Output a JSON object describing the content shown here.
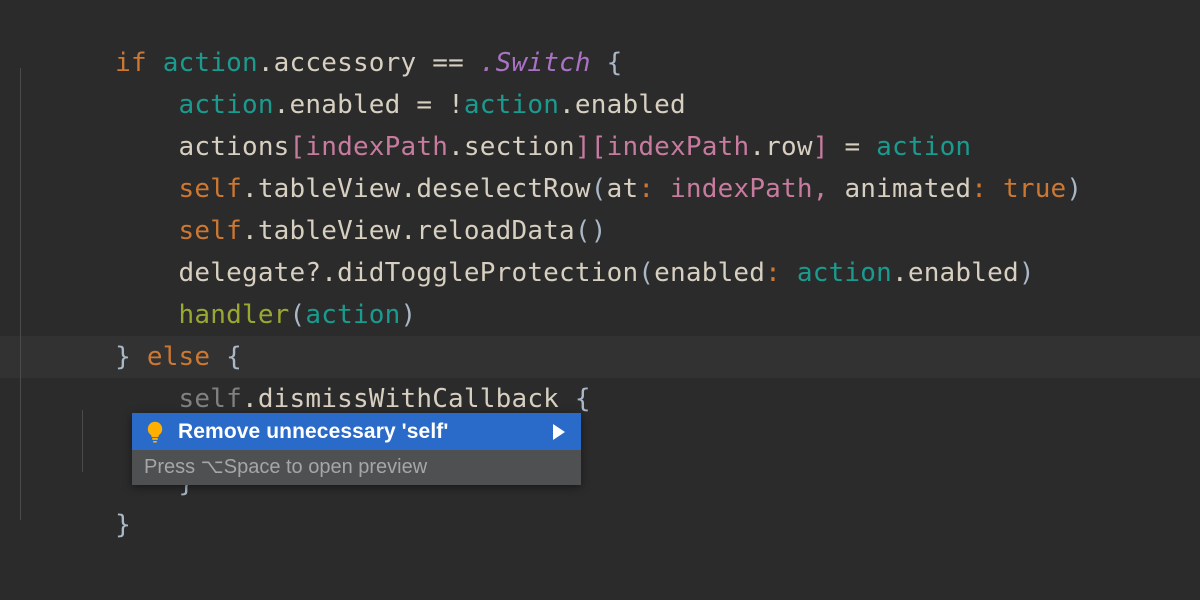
{
  "editor": {
    "background_color": "#2b2b2b",
    "current_line_color": "#323232",
    "font_size_px": 26,
    "lines": [
      {
        "id": "line-1",
        "text": "if action.accessory == .Switch {"
      },
      {
        "id": "line-2",
        "text": "    action.enabled = !action.enabled"
      },
      {
        "id": "line-3",
        "text": "    actions[indexPath.section][indexPath.row] = action"
      },
      {
        "id": "line-4",
        "text": "    self.tableView.deselectRow(at: indexPath, animated: true)"
      },
      {
        "id": "line-5",
        "text": "    self.tableView.reloadData()"
      },
      {
        "id": "line-6",
        "text": "    delegate?.didToggleProtection(enabled: action.enabled)"
      },
      {
        "id": "line-7",
        "text": "    handler(action)"
      },
      {
        "id": "line-8",
        "text": "} else {"
      },
      {
        "id": "line-9",
        "text": "    self.dismissWithCallback {",
        "current": true
      },
      {
        "id": "line-10",
        "text": ""
      },
      {
        "id": "line-11",
        "text": "    }"
      },
      {
        "id": "line-12",
        "text": "}"
      }
    ],
    "tokens": {
      "keyword_if": "if",
      "keyword_else": "else",
      "keyword_self": "self",
      "keyword_true": "true",
      "variable_action": "action",
      "variable_actions": "actions",
      "variable_indexPath": "indexPath",
      "variable_delegate": "delegate",
      "enum_case_switch": ".Switch",
      "function_handler": "handler",
      "member_accessory": ".accessory",
      "member_enabled": ".enabled",
      "member_section": ".section",
      "member_row": ".row",
      "member_tableView": ".tableView",
      "method_deselectRow": ".deselectRow",
      "method_reloadData": ".reloadData",
      "method_didToggleProtection": ".didToggleProtection",
      "method_dismissWithCallback": ".dismissWithCallback",
      "label_at": "at",
      "label_animated": "animated",
      "label_enabled": "enabled"
    },
    "colors": {
      "keyword": "#cc7832",
      "identifier": "#d7cfc0",
      "variable_teal": "#1a9b8f",
      "property_pink": "#c77b9e",
      "enum_purple": "#a972c4",
      "function_olive": "#9aa832",
      "paren": "#a9b7c6",
      "dimmed": "#808080",
      "indent_guide": "#4b4b4b"
    }
  },
  "intention_popup": {
    "icon": "lightbulb-icon",
    "label": "Remove unnecessary 'self'",
    "has_submenu": true,
    "submenu_icon": "triangle-right-icon",
    "hint": "Press ⌥Space to open preview",
    "highlight_color": "#2a6ac8",
    "hint_background_color": "#4e5052",
    "hint_text_color": "#a6a6a6",
    "bulb_color": "#ffb000"
  }
}
